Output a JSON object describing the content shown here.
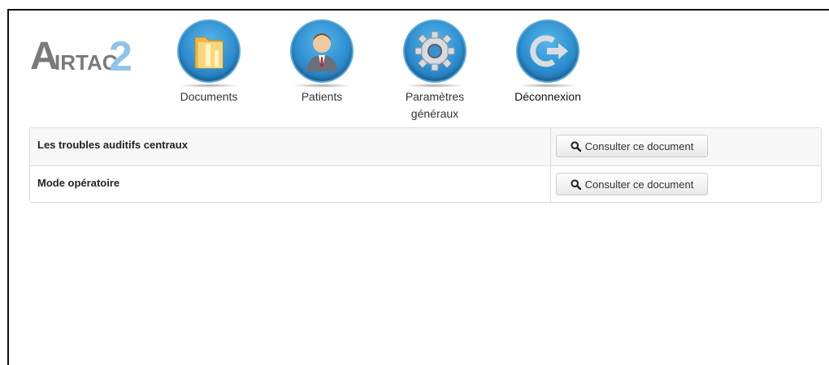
{
  "logo": {
    "text_a": "A",
    "text_rtac": "IRTAC",
    "text_two": "2"
  },
  "nav": {
    "items": [
      {
        "label": "Documents",
        "icon": "folder-icon"
      },
      {
        "label": "Patients",
        "icon": "user-icon"
      },
      {
        "label_line1": "Paramètres",
        "label_line2": "généraux",
        "icon": "gear-icon"
      },
      {
        "label": "Déconnexion",
        "icon": "logout-icon"
      }
    ]
  },
  "documents": {
    "rows": [
      {
        "title": "Les troubles auditifs centraux",
        "button_label": "Consulter ce document",
        "button_icon": "search-icon"
      },
      {
        "title": "Mode opératoire",
        "button_label": "Consulter ce document",
        "button_icon": "search-icon"
      }
    ]
  }
}
